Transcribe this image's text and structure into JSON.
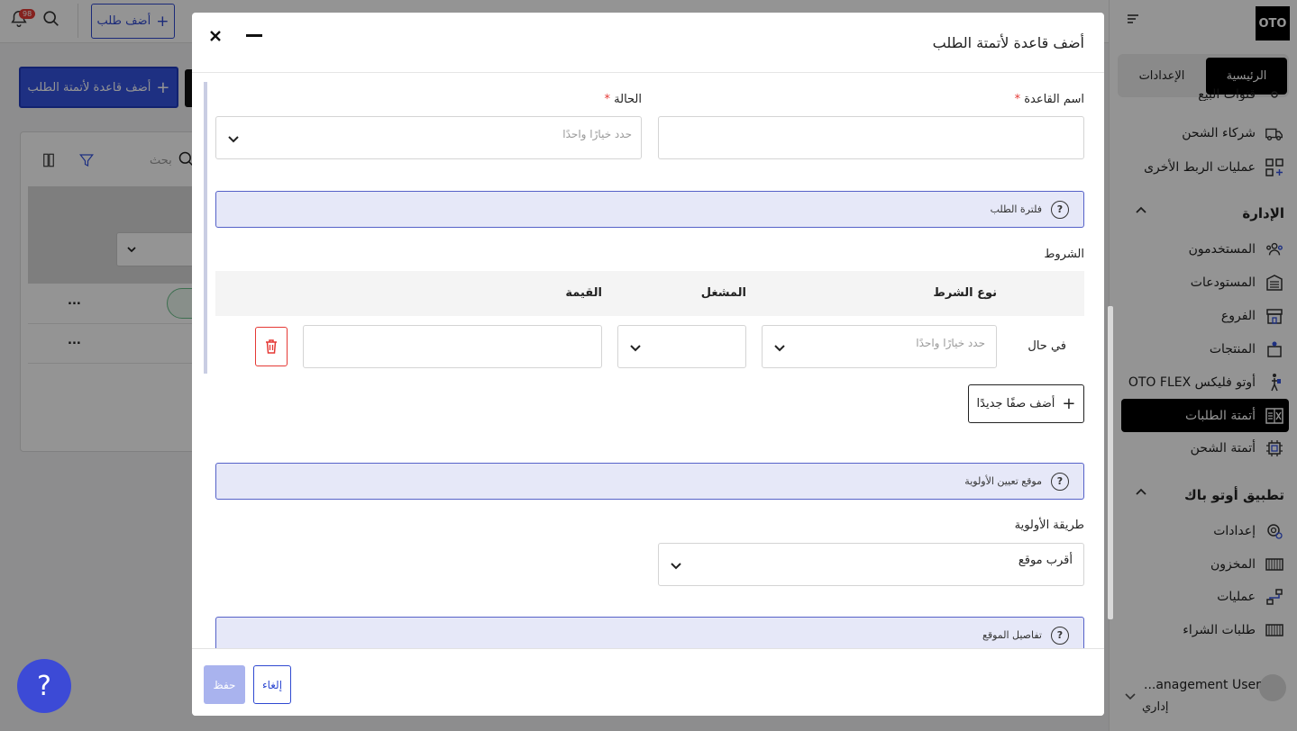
{
  "topbar": {
    "add_order_label": "أضف طلب",
    "notification_count": "98"
  },
  "sidebar": {
    "logo_text": "OTO",
    "tabs": [
      {
        "label": "الرئيسية",
        "active": true
      },
      {
        "label": "الإعدادات",
        "active": false
      }
    ],
    "items": [
      {
        "label": "قنوات البيع",
        "icon": "sales-channels-icon"
      },
      {
        "label": "شركاء الشحن",
        "icon": "truck-icon"
      },
      {
        "label": "عمليات الربط الأخرى",
        "icon": "grid-plus-icon"
      }
    ],
    "management": {
      "heading": "الإدارة",
      "items": [
        {
          "label": "المستخدمون",
          "icon": "users-icon"
        },
        {
          "label": "المستودعات",
          "icon": "warehouse-icon"
        },
        {
          "label": "الفروع",
          "icon": "store-icon"
        },
        {
          "label": "المنتجات",
          "icon": "products-icon"
        },
        {
          "label": "أوتو فليكس OTO FLEX",
          "icon": "walker-icon"
        },
        {
          "label": "أتمتة الطلبات",
          "icon": "automation-icon",
          "active": true
        },
        {
          "label": "أتمتة الشحن",
          "icon": "chip-icon"
        }
      ]
    },
    "otoback": {
      "heading": "تطبيق أوتو باك",
      "items": [
        {
          "label": "إعدادات",
          "icon": "settings-icon"
        },
        {
          "label": "المخزون",
          "icon": "inventory-icon"
        },
        {
          "label": "عمليات",
          "icon": "operations-icon"
        },
        {
          "label": "طلبات الشراء",
          "icon": "purchase-icon"
        }
      ]
    },
    "user": {
      "name": "...anagement User",
      "role": "إداري"
    }
  },
  "page": {
    "add_rule_label": "أضف قاعدة لأتمتة الطلب",
    "search_placeholder": "بحث",
    "row_more": "..."
  },
  "modal": {
    "title": "أضف قاعدة لأتمتة الطلب",
    "rule_name_label": "اسم القاعدة",
    "status_label": "الحالة",
    "status_placeholder": "حدد خيارًا واحدًا",
    "required_mark": "*",
    "order_filter_banner": "فلترة الطلب",
    "conditions_label": "الشروط",
    "table_headers": {
      "condition_type": "نوع الشرط",
      "operator": "المشغل",
      "value": "القيمة"
    },
    "condition_row": {
      "prefix": "في حال",
      "type_placeholder": "حدد خيارًا واحدًا"
    },
    "add_row_label": "أضف صفًا جديدًا",
    "priority_banner": "موقع تعيين الأولوية",
    "priority_method_label": "طريقة الأولوية",
    "priority_method_value": "أقرب موقع",
    "location_details_banner": "تفاصيل الموقع",
    "save_label": "حفظ",
    "cancel_label": "إلغاء"
  },
  "colors": {
    "accent": "#3454e0",
    "banner_bg": "#e6e8f8",
    "danger": "#e53935",
    "active_nav": "#000000"
  }
}
